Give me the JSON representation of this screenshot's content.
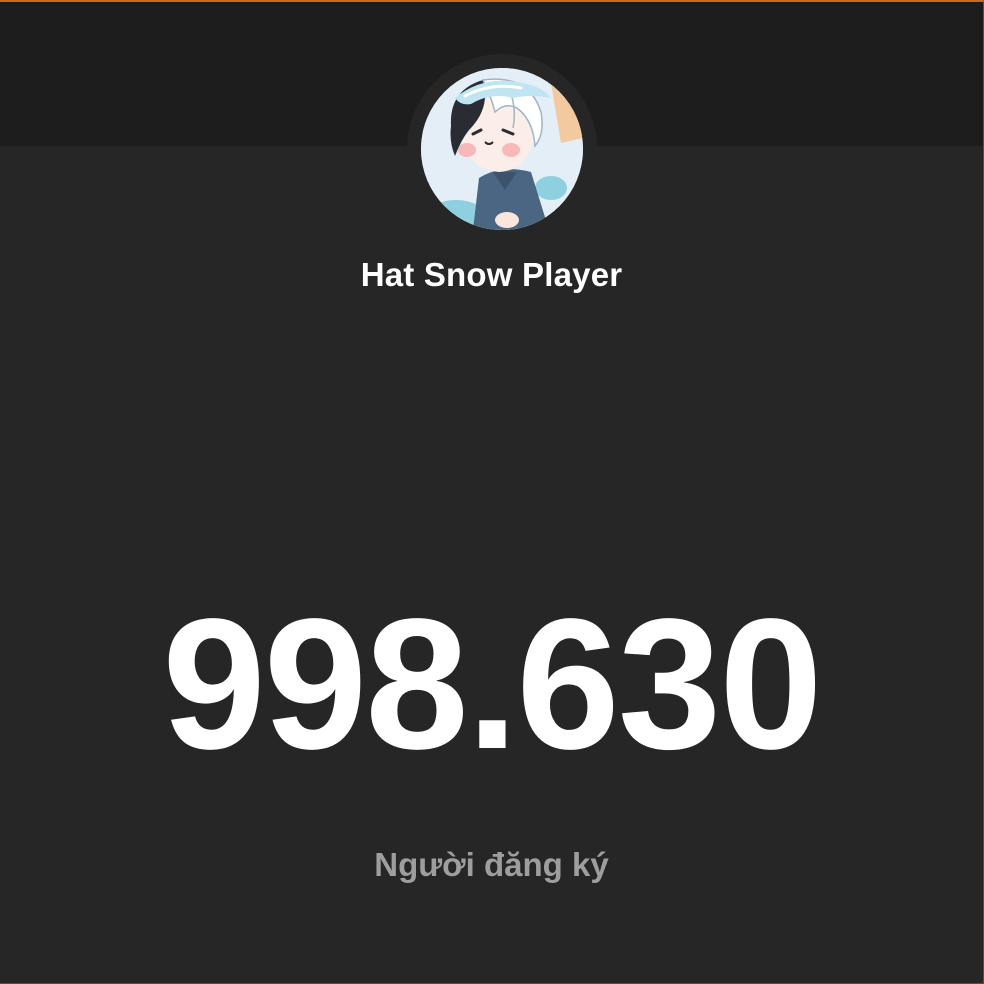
{
  "channel": {
    "name": "Hat Snow Player",
    "avatar_icon": "anime-avatar-icon"
  },
  "counter": {
    "value": "998.630",
    "label": "Người đăng ký"
  },
  "colors": {
    "background": "#262626",
    "top_band": "#1d1d1d",
    "count_text": "#ffffff",
    "label_text": "#9e9e9e",
    "frame_accent": "#c96a22"
  }
}
